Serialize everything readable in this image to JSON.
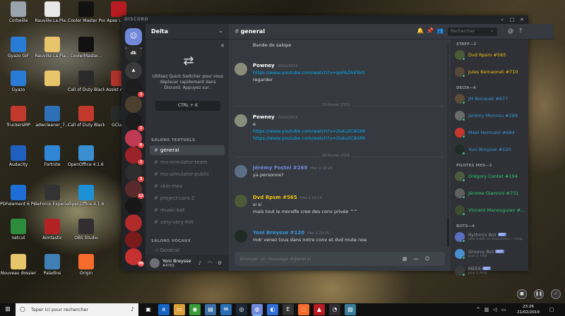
{
  "desktop": {
    "icons": [
      {
        "label": "Corbeille",
        "icon": "trash-icon",
        "color": "#9aa4ad"
      },
      {
        "label": "Rauville.La.Pla...",
        "icon": "document-icon",
        "color": "#e8e8e8"
      },
      {
        "label": "Cooler Master Portal",
        "icon": "cooler-master-icon",
        "color": "#111111"
      },
      {
        "label": "Apex Leg...",
        "icon": "apex-icon",
        "color": "#b81c22"
      },
      {
        "label": "Gyazo GIF",
        "icon": "gyazo-icon",
        "color": "#2a7bd4"
      },
      {
        "label": "Rauville.La.Pla...",
        "icon": "folder-icon",
        "color": "#e8c46a"
      },
      {
        "label": "CoolerMaster...",
        "icon": "cooler-master-icon",
        "color": "#111111"
      },
      {
        "label": "Gyazo",
        "icon": "gyazo-icon",
        "color": "#2a7bd4"
      },
      {
        "label": "",
        "icon": "folder-icon",
        "color": "#e8c46a"
      },
      {
        "label": "Call of Duty Black Ops...",
        "icon": "cod-icon",
        "color": "#2a2a2a"
      },
      {
        "label": "Assist Ass...",
        "icon": "app-icon",
        "color": "#b0332a"
      },
      {
        "label": "TruckersMP",
        "icon": "truckersmp-icon",
        "color": "#c0392b"
      },
      {
        "label": "adwcleaner_7...",
        "icon": "adwcleaner-icon",
        "color": "#2e6fb5"
      },
      {
        "label": "Call of Duty Black Ops...",
        "icon": "cod-icon",
        "color": "#c0392b"
      },
      {
        "label": "GCla...",
        "icon": "app-icon",
        "color": "#2a2a2a"
      },
      {
        "label": "Audacity",
        "icon": "audacity-icon",
        "color": "#1f5fbf"
      },
      {
        "label": "Fortnite",
        "icon": "fortnite-icon",
        "color": "#2f86d6"
      },
      {
        "label": "OpenOffice 4.1.6 (fr) Installatio...",
        "icon": "openoffice-icon",
        "color": "#3a8fd1"
      },
      {
        "label": "PDFelement 6 Pro",
        "icon": "pdf-icon",
        "color": "#1e6ed6"
      },
      {
        "label": "GeForce Experience",
        "icon": "geforce-icon",
        "color": "#333333"
      },
      {
        "label": "OpenOffice 4.1.6",
        "icon": "openoffice-icon",
        "color": "#1e90d6"
      },
      {
        "label": "netcut",
        "icon": "netcut-icon",
        "color": "#2c8c3c"
      },
      {
        "label": "Aimtastic",
        "icon": "aimtastic-icon",
        "color": "#b22222"
      },
      {
        "label": "OBS Studio",
        "icon": "obs-icon",
        "color": "#302e31"
      },
      {
        "label": "Nouveau dossier",
        "icon": "folder-icon",
        "color": "#e8c46a"
      },
      {
        "label": "Paladins",
        "icon": "paladins-icon",
        "color": "#3f7fb5"
      },
      {
        "label": "Origin",
        "icon": "origin-icon",
        "color": "#f56c2d"
      }
    ]
  },
  "discord": {
    "app_name": "DISCORD",
    "window_buttons": [
      "–",
      "□",
      "✕"
    ],
    "guild_list": {
      "online_label": "0 en ligne",
      "guilds": [
        {
          "label": "",
          "color": "#7289da",
          "badge": ""
        },
        {
          "label": "dk",
          "color": "#2b2b2b",
          "badge": ""
        },
        {
          "label": "▲",
          "color": "#3a3a3a",
          "badge": ""
        },
        {
          "label": "",
          "color": "#1d1d1d",
          "badge": "3"
        },
        {
          "label": "",
          "color": "#4c3f2d",
          "badge": ""
        },
        {
          "label": "",
          "color": "#1b1b1b",
          "badge": "3"
        },
        {
          "label": "",
          "color": "#c03a54",
          "badge": "8"
        },
        {
          "label": "",
          "color": "#9b2226",
          "badge": "2"
        },
        {
          "label": "",
          "color": "#2d2d2d",
          "badge": "3"
        },
        {
          "label": "",
          "color": "#5a2a2a",
          "badge": "12"
        },
        {
          "label": "",
          "color": "#171717",
          "badge": ""
        },
        {
          "label": "",
          "color": "#b22b2b",
          "badge": ""
        },
        {
          "label": "",
          "color": "#7a1b1b",
          "badge": ""
        },
        {
          "label": "",
          "color": "#c53030",
          "badge": "99"
        }
      ]
    },
    "server": {
      "name": "Delta",
      "quick_switcher": {
        "text": "Utilisez Quick Switcher pour vous déplacer rapidement dans Discord. Appuyez sur :",
        "shortcut": "CTRL + K"
      },
      "text_category": "SALONS TEXTUELS",
      "text_channels": [
        {
          "name": "general",
          "active": true
        },
        {
          "name": "mx-simulator-team",
          "active": false
        },
        {
          "name": "mx-simulator-public",
          "active": false
        },
        {
          "name": "skin-mxs",
          "active": false
        },
        {
          "name": "project-cars-2",
          "active": false
        },
        {
          "name": "music-bot",
          "active": false
        },
        {
          "name": "very-very-hot",
          "active": false
        }
      ],
      "voice_category": "SALONS VOCAUX",
      "voice_channels": [
        {
          "name": "Général"
        }
      ]
    },
    "user": {
      "name": "Yoni Breysse",
      "tag": "#4765"
    },
    "chat": {
      "channel": "general",
      "search_placeholder": "Rechercher",
      "messages": [
        {
          "author": "",
          "color": "#ffffff",
          "timestamp": "",
          "lines": [
            "Bande de salope"
          ],
          "links": [],
          "avatar": "#777777"
        },
        {
          "author": "Powney",
          "color": "#ffffff",
          "timestamp": "20/02/2019",
          "lines": [
            "regarder"
          ],
          "links": [
            "https://www.youtube.com/watch?v=qoFAZ6XToO"
          ],
          "avatar": "#8a8d7a"
        },
        {
          "author": "Powney",
          "color": "#ffffff",
          "timestamp": "20/02/2019",
          "lines": [
            "e"
          ],
          "links": [
            "https://www.youtube.com/watch?v=2lalu2C9GMI",
            "https://www.youtube.com/watch?v=2lalu2C9GMI"
          ],
          "avatar": "#8a8d7a"
        },
        {
          "author": "Jérémy Postel #268",
          "color": "#7289da",
          "timestamp": "Hier à 18:24",
          "lines": [
            "ya personne?"
          ],
          "links": [],
          "avatar": "#5b6e83"
        },
        {
          "author": "Dvd Rpsm #565",
          "color": "#f1c40f",
          "timestamp": "Hier à 20:14",
          "lines": [
            "si si",
            "mais tout le mondfe cree des conv privée ^^"
          ],
          "links": [],
          "avatar": "#4b5b36"
        },
        {
          "author": "Yoni Breysse #120",
          "color": "#3498db",
          "timestamp": "Hier à 20:15",
          "lines": [
            "mdr venez tous dans notre conv et dvd mute noa"
          ],
          "links": [],
          "avatar": "#1f2b24"
        }
      ],
      "dividers": [
        "15 février 2019",
        "20 février 2019"
      ],
      "composer_placeholder": "Envoyer un message #general"
    },
    "members": {
      "roles": [
        {
          "title": "STAFF—2",
          "members": [
            {
              "name": "Dvd Rpsm #565",
              "color": "#f1c40f",
              "status": "#43b581",
              "avatar": "#4b5b36"
            },
            {
              "name": "Jules Kernaonet #710",
              "color": "#f1c40f",
              "status": "#43b581",
              "avatar": "#56493a"
            }
          ]
        },
        {
          "title": "DELTA—4",
          "members": [
            {
              "name": "JM Bocquet #677",
              "color": "#3498db",
              "status": "#43b581",
              "avatar": "#5c4d3a"
            },
            {
              "name": "Jérémy Monceu #289",
              "color": "#3498db",
              "status": "#43b581",
              "avatar": "#6b6a6a"
            },
            {
              "name": "Maël Hermant #684",
              "color": "#3498db",
              "status": "#43b581",
              "avatar": "#c7382e"
            },
            {
              "name": "Yoni Breysse #120",
              "color": "#3498db",
              "status": "#43b581",
              "avatar": "#1f2b24"
            }
          ]
        },
        {
          "title": "PILOTES MXS—3",
          "members": [
            {
              "name": "Grégory Contet #194",
              "color": "#2ecc71",
              "status": "#43b581",
              "avatar": "#4c5c40"
            },
            {
              "name": "Jérome Giannini #731",
              "color": "#2ecc71",
              "status": "#43b581",
              "avatar": "#606060"
            },
            {
              "name": "Vincent Manouguian #...",
              "color": "#2ecc71",
              "status": "#43b581",
              "avatar": "#3a4d2e"
            }
          ]
        },
        {
          "title": "BOTS—4",
          "members": [
            {
              "name": "Rythmix Bot",
              "sub": "Joue à with an Executions... / Help",
              "color": "#8e9297",
              "status": "#43b581",
              "avatar": "#5b6fbf",
              "bot": "BOT"
            },
            {
              "name": "Groovy Bot",
              "sub": "Joue à -help",
              "color": "#8e9297",
              "status": "#43b581",
              "avatar": "#4a8fd0",
              "bot": "BOT"
            },
            {
              "name": "MEE6",
              "sub": "Joue à /help",
              "color": "#8e9297",
              "status": "#43b581",
              "avatar": "#3b3b3b",
              "bot": "BOT"
            }
          ]
        }
      ]
    }
  },
  "taskbar": {
    "search_placeholder": "Taper ici pour rechercher",
    "apps": [
      {
        "icon": "task-view-icon",
        "glyph": "▣",
        "color": "#101010",
        "active": false
      },
      {
        "icon": "edge-icon",
        "glyph": "e",
        "color": "#1565c0",
        "active": false
      },
      {
        "icon": "explorer-icon",
        "glyph": "▭",
        "color": "#d9a33a",
        "active": false
      },
      {
        "icon": "chrome-icon",
        "glyph": "◉",
        "color": "#3b9c3b",
        "active": false
      },
      {
        "icon": "store-icon",
        "glyph": "▤",
        "color": "#3a6ea5",
        "active": false
      },
      {
        "icon": "mail-icon",
        "glyph": "✉",
        "color": "#2a6fb5",
        "active": false
      },
      {
        "icon": "steam-icon",
        "glyph": "◎",
        "color": "#1b2838",
        "active": false
      },
      {
        "icon": "discord-icon",
        "glyph": "◍",
        "color": "#7289da",
        "active": true
      },
      {
        "icon": "uplay-icon",
        "glyph": "◐",
        "color": "#2f6fd6",
        "active": false
      },
      {
        "icon": "epic-icon",
        "glyph": "E",
        "color": "#333333",
        "active": false
      },
      {
        "icon": "origin-icon",
        "glyph": "◌",
        "color": "#f56c2d",
        "active": false
      },
      {
        "icon": "app-icon",
        "glyph": "▲",
        "color": "#b81c22",
        "active": false
      },
      {
        "icon": "obs-icon",
        "glyph": "◔",
        "color": "#302e31",
        "active": false
      },
      {
        "icon": "photo-icon",
        "glyph": "▧",
        "color": "#3a7d9c",
        "active": false
      }
    ],
    "clock_time": "23:26",
    "clock_date": "21/02/2019"
  }
}
